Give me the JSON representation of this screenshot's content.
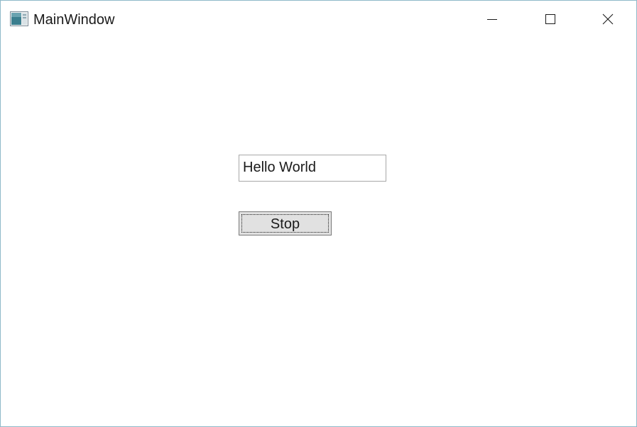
{
  "window": {
    "title": "MainWindow",
    "controls": {
      "minimize_icon": "minimize-icon",
      "maximize_icon": "maximize-icon",
      "close_icon": "close-icon"
    },
    "border_color": "#8fb9c9"
  },
  "content": {
    "text_field": {
      "value": "Hello World"
    },
    "stop_button": {
      "label": "Stop",
      "background": "#e1e1e1"
    }
  }
}
